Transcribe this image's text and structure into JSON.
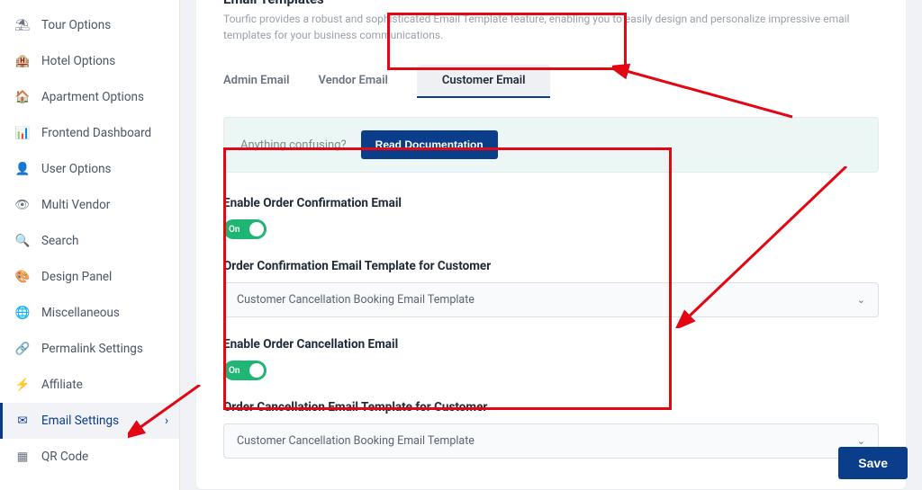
{
  "sidebar": {
    "items": [
      {
        "label": "Tour Options",
        "icon": "umbrella-icon"
      },
      {
        "label": "Hotel Options",
        "icon": "building-icon"
      },
      {
        "label": "Apartment Options",
        "icon": "home-icon"
      },
      {
        "label": "Frontend Dashboard",
        "icon": "gauge-icon"
      },
      {
        "label": "User Options",
        "icon": "user-icon"
      },
      {
        "label": "Multi Vendor",
        "icon": "eye-icon"
      },
      {
        "label": "Search",
        "icon": "search-icon"
      },
      {
        "label": "Design Panel",
        "icon": "palette-icon"
      },
      {
        "label": "Miscellaneous",
        "icon": "globe-icon"
      },
      {
        "label": "Permalink Settings",
        "icon": "link-icon"
      },
      {
        "label": "Affiliate",
        "icon": "bolt-icon"
      },
      {
        "label": "Email Settings",
        "icon": "envelope-icon"
      },
      {
        "label": "QR Code",
        "icon": "qr-icon"
      }
    ],
    "active_index": 11
  },
  "page": {
    "title": "Email Templates",
    "subtitle": "Tourfic provides a robust and sophisticated Email Template feature, enabling you to easily design and personalize impressive email templates for your business communications."
  },
  "tabs": {
    "items": [
      "Admin Email",
      "Vendor Email",
      "Customer Email"
    ],
    "active_index": 2
  },
  "help": {
    "text": "Anything confusing?",
    "button": "Read Documentation"
  },
  "form": {
    "enable_confirm_label": "Enable Order Confirmation Email",
    "confirm_toggle_text": "On",
    "confirm_tpl_label": "Order Confirmation Email Template for Customer",
    "confirm_tpl_value": "Customer Cancellation Booking Email Template",
    "enable_cancel_label": "Enable Order Cancellation Email",
    "cancel_toggle_text": "On",
    "cancel_tpl_label": "Order Cancellation Email Template for Customer",
    "cancel_tpl_value": "Customer Cancellation Booking Email Template"
  },
  "save_label": "Save"
}
